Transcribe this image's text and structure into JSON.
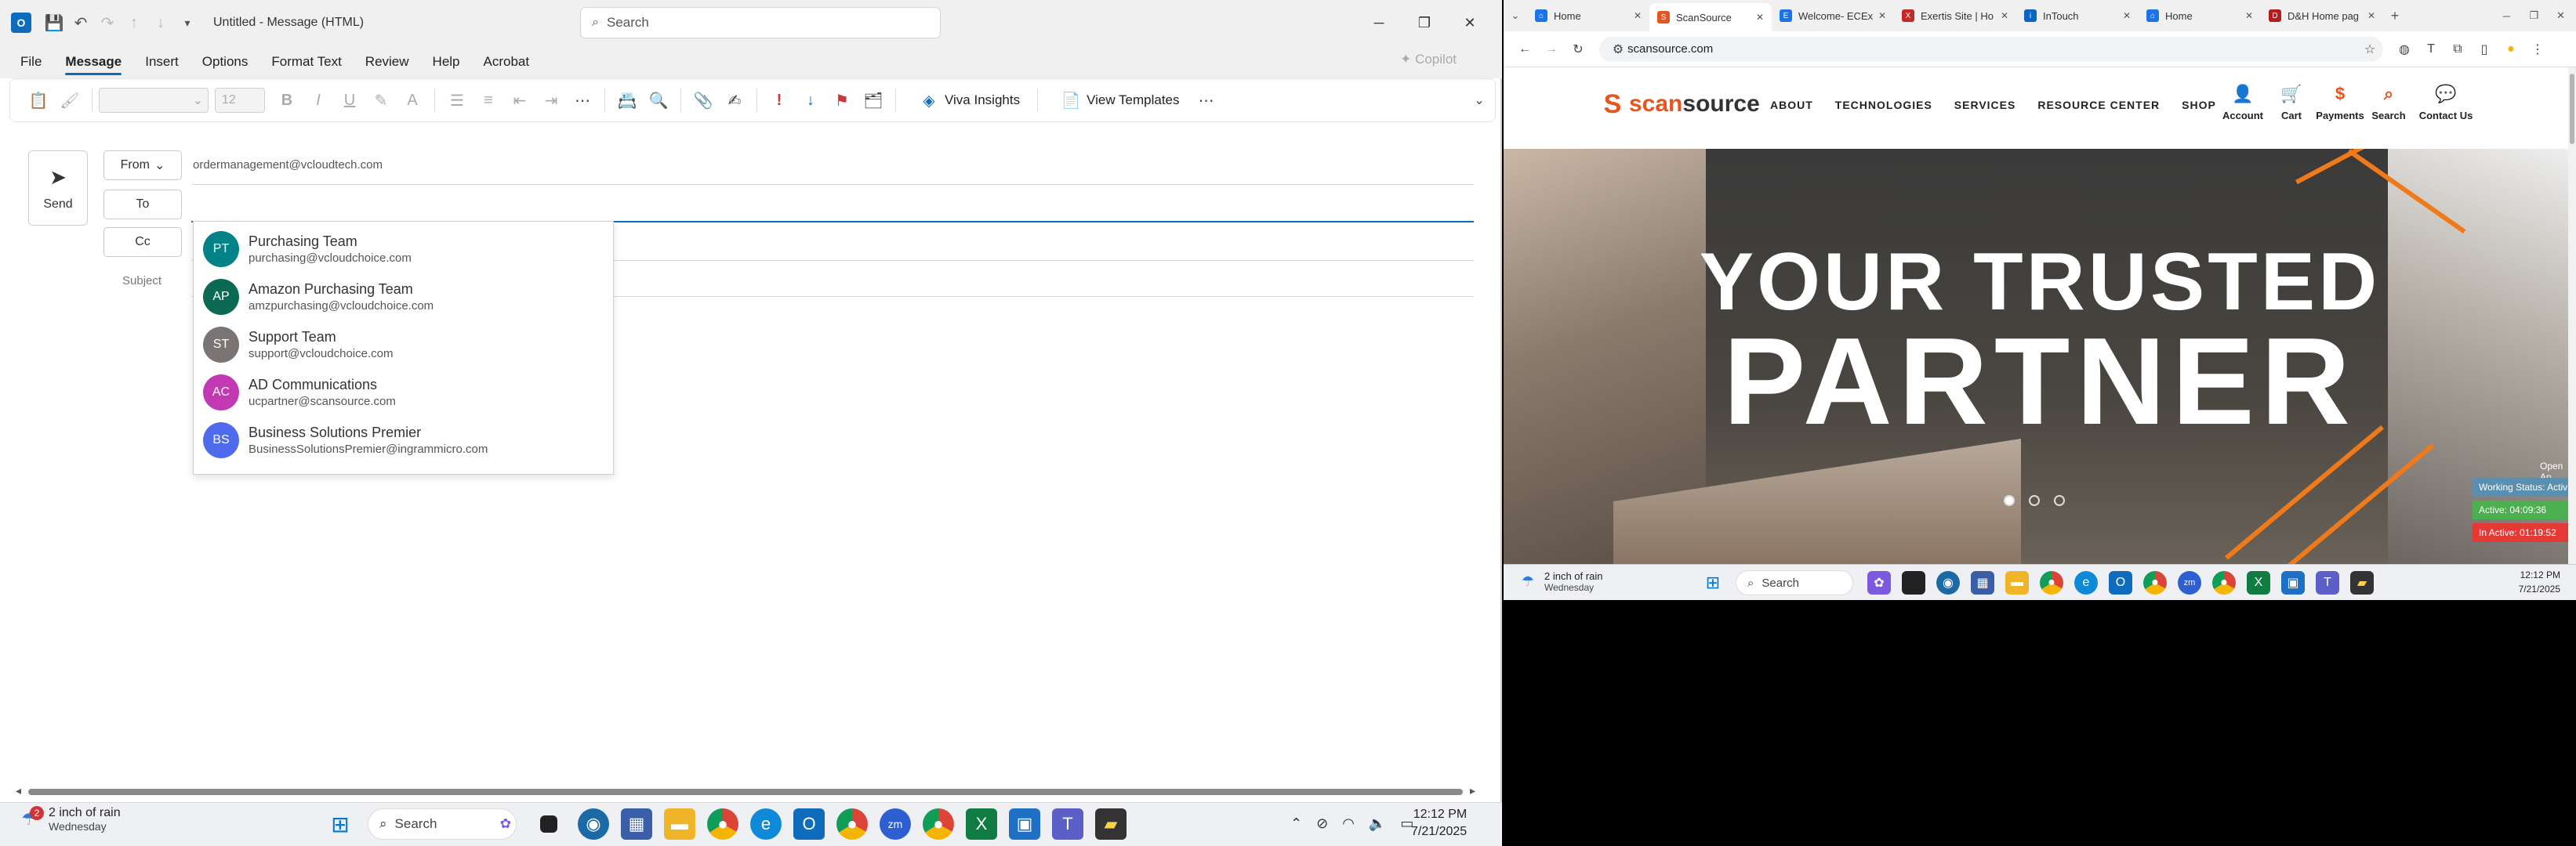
{
  "outlook": {
    "window_title": "Untitled  -  Message (HTML)",
    "search_placeholder": "Search",
    "menu": [
      "File",
      "Message",
      "Insert",
      "Options",
      "Format Text",
      "Review",
      "Help",
      "Acrobat"
    ],
    "copilot": "Copilot",
    "font_size": "12",
    "viva_insights": "Viva Insights",
    "view_templates": "View Templates",
    "send": "Send",
    "from_btn": "From",
    "to_btn": "To",
    "cc_btn": "Cc",
    "from_value": "ordermanagement@vcloudtech.com",
    "subject_label": "Subject",
    "suggestions": [
      {
        "initials": "PT",
        "name": "Purchasing Team",
        "email": "purchasing@vcloudchoice.com",
        "color": "#038387"
      },
      {
        "initials": "AP",
        "name": "Amazon Purchasing Team",
        "email": "amzpurchasing@vcloudchoice.com",
        "color": "#0b6a54"
      },
      {
        "initials": "ST",
        "name": "Support Team",
        "email": "support@vcloudchoice.com",
        "color": "#7a7574"
      },
      {
        "initials": "AC",
        "name": "AD Communications",
        "email": "ucpartner@scansource.com",
        "color": "#c239b3"
      },
      {
        "initials": "BS",
        "name": "Business Solutions Premier",
        "email": "BusinessSolutionsPremier@ingrammicro.com",
        "color": "#4f6bed"
      }
    ]
  },
  "taskbar": {
    "weather_main": "2 inch of rain",
    "weather_sub": "Wednesday",
    "weather_badge": "2",
    "search": "Search",
    "time": "12:12 PM",
    "date": "7/21/2025"
  },
  "browser": {
    "tabs": [
      {
        "title": "Home",
        "color": "#1a73e8",
        "active": false
      },
      {
        "title": "ScanSource",
        "color": "#e8541e",
        "active": true
      },
      {
        "title": "Welcome- ECEx",
        "color": "#1a73e8",
        "active": false
      },
      {
        "title": "Exertis Site | Ho",
        "color": "#c62828",
        "active": false
      },
      {
        "title": "InTouch",
        "color": "#0a66c2",
        "active": false
      },
      {
        "title": "Home",
        "color": "#1a73e8",
        "active": false
      },
      {
        "title": "D&H Home pag",
        "color": "#b71c1c",
        "active": false
      }
    ],
    "url": "scansource.com"
  },
  "site": {
    "logo_scan": "scan",
    "logo_source": "source",
    "nav": [
      "ABOUT",
      "TECHNOLOGIES",
      "SERVICES",
      "RESOURCE CENTER",
      "SHOP"
    ],
    "util": [
      {
        "label": "Account",
        "icon": "account-icon",
        "glyph": "👤"
      },
      {
        "label": "Cart",
        "icon": "cart-icon",
        "glyph": "🛒"
      },
      {
        "label": "Payments",
        "icon": "dollar-icon",
        "glyph": "$"
      },
      {
        "label": "Search",
        "icon": "search-icon",
        "glyph": "⌕"
      },
      {
        "label": "Contact Us",
        "icon": "chat-icon",
        "glyph": "💬"
      }
    ],
    "hero_line1": "YOUR TRUSTED",
    "hero_line2": "PARTNER",
    "open_app": "Open Ap",
    "status": [
      {
        "text": "Working Status: Activ",
        "color": "#5a8fb0"
      },
      {
        "text": "Active: 04:09:36",
        "color": "#4caf50"
      },
      {
        "text": "In Active: 01:19:52",
        "color": "#e53935"
      }
    ]
  },
  "remote_taskbar": {
    "weather_main": "2 inch of rain",
    "weather_sub": "Wednesday",
    "search": "Search",
    "time": "12:12 PM",
    "date": "7/21/2025"
  }
}
